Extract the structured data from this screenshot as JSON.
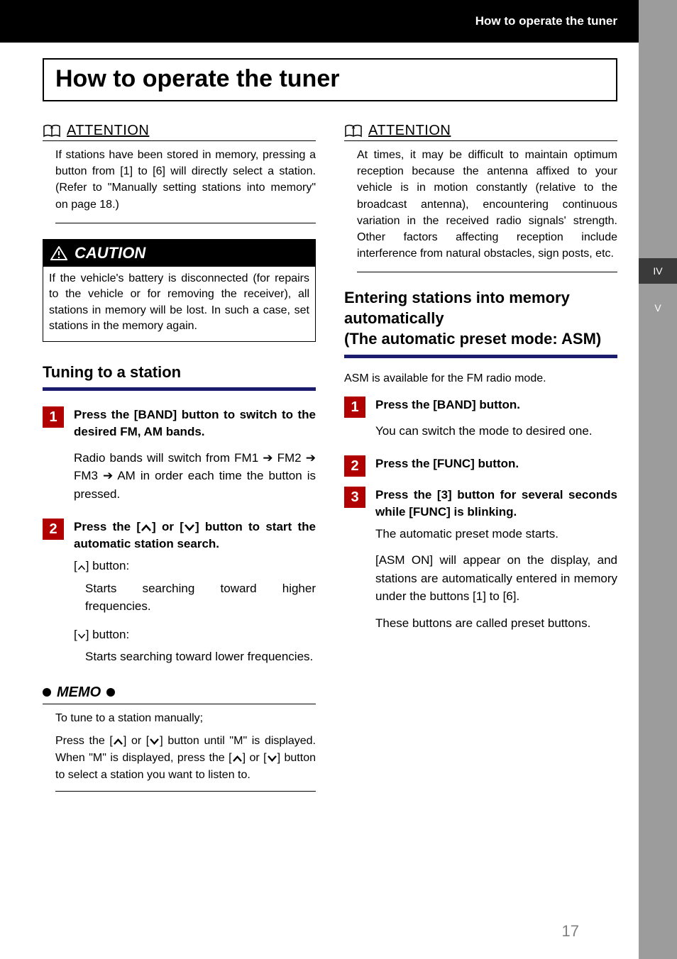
{
  "header": {
    "running_head": "How to operate the tuner",
    "title": "How to operate the tuner"
  },
  "side_tabs": {
    "iv": "IV",
    "v": "V"
  },
  "left": {
    "attention_label": "ATTENTION",
    "attention_text": "If stations have been stored in memory, pressing a button from [1] to [6] will directly select a station. (Refer to \"Manually setting stations into memory\" on page 18.)",
    "caution_label": "CAUTION",
    "caution_text": "If the vehicle's battery is disconnected (for repairs to the vehicle or for removing the receiver), all stations in memory will be lost. In such a case, set stations in the memory again.",
    "tuning_heading": "Tuning to a station",
    "step1_num": "1",
    "step1_title": "Press the [BAND] button to switch to the desired FM, AM bands.",
    "step1_desc": "Radio bands will switch from FM1 ➔ FM2 ➔ FM3 ➔ AM in order each time the button is pressed.",
    "step2_num": "2",
    "step2_title_a": "Press the [",
    "step2_title_b": "] or [",
    "step2_title_c": "] button to start the automatic station search.",
    "step2_up_label_a": "[",
    "step2_up_label_b": "] button:",
    "step2_up_desc": "Starts searching toward higher frequencies.",
    "step2_down_label_a": "[",
    "step2_down_label_b": "] button:",
    "step2_down_desc": "Starts searching toward lower frequencies.",
    "memo_label": "MEMO",
    "memo_line1": "To tune to a station manually;",
    "memo_line2_a": "Press the [",
    "memo_line2_b": "] or [",
    "memo_line2_c": "] button until \"M\" is displayed.  When \"M\" is displayed, press the [",
    "memo_line2_d": "] or [",
    "memo_line2_e": "] button to select a station you want to listen to."
  },
  "right": {
    "attention_label": "ATTENTION",
    "attention_text": "At times, it may be difficult to maintain optimum reception because the antenna affixed to your vehicle is in motion constantly (relative to the broadcast antenna), encountering continuous variation in the received radio signals' strength. Other factors affecting reception include interference from natural obstacles, sign posts, etc.",
    "heading": "Entering stations into memory automatically\n(The automatic preset mode: ASM)",
    "asm_intro": "ASM is available for the FM radio mode.",
    "step1_num": "1",
    "step1_title": "Press the [BAND] button.",
    "step1_desc": "You can switch the mode to desired one.",
    "step2_num": "2",
    "step2_title": "Press the [FUNC] button.",
    "step3_num": "3",
    "step3_title": "Press the [3] button for several seconds while [FUNC] is blinking.",
    "step3_desc1": "The automatic preset mode starts.",
    "step3_desc2": "[ASM ON] will appear on the display, and stations are automatically entered in memory under the buttons [1] to [6].",
    "step3_desc3": "These buttons are called preset buttons."
  },
  "page_number": "17"
}
